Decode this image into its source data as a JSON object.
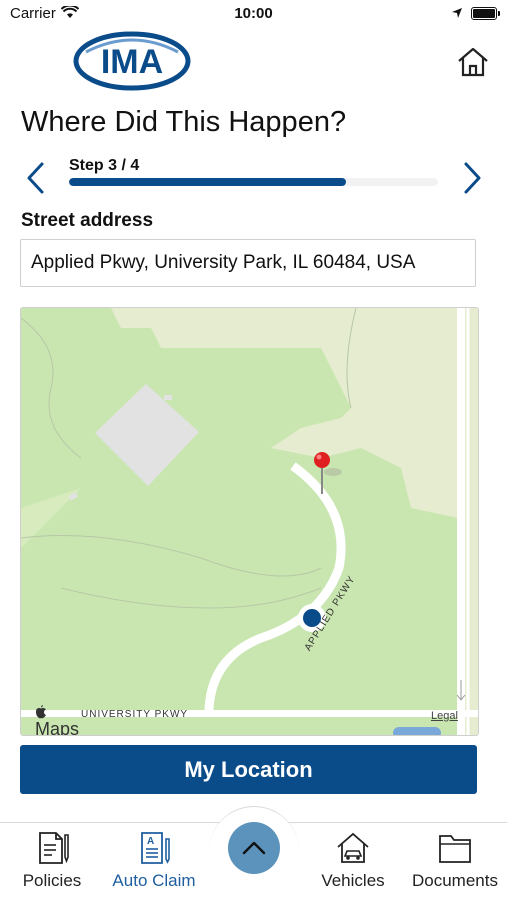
{
  "status_bar": {
    "carrier": "Carrier",
    "time": "10:00"
  },
  "header": {
    "logo_text": "IMA",
    "home_icon": "home-icon"
  },
  "page": {
    "title": "Where Did This Happen?",
    "step_label": "Step 3 / 4",
    "progress_fraction": 0.75
  },
  "address": {
    "label": "Street address",
    "value": "Applied Pkwy, University Park, IL 60484, USA"
  },
  "map": {
    "brand": "Maps",
    "legal": "Legal",
    "road_labels": [
      "APPLIED PKWY",
      "UNIVERSITY PKWY"
    ],
    "colors": {
      "land": "#e6ecd0",
      "park": "#c9e6b0",
      "road": "#ffffff",
      "user_dot": "#0a4b8a",
      "pin": "#e02020"
    }
  },
  "my_location_button": "My Location",
  "tabbar": {
    "items": [
      {
        "label": "Policies",
        "icon": "document-pen-icon"
      },
      {
        "label": "Auto Claim",
        "icon": "claim-form-icon",
        "active": true
      },
      {
        "label": "Vehicles",
        "icon": "house-car-icon"
      },
      {
        "label": "Documents",
        "icon": "folder-icon"
      }
    ],
    "center_button_icon": "chevron-up-icon"
  },
  "colors": {
    "primary": "#0a4b8a",
    "active_tab": "#1f5fa0",
    "fab": "#5b93bd"
  }
}
